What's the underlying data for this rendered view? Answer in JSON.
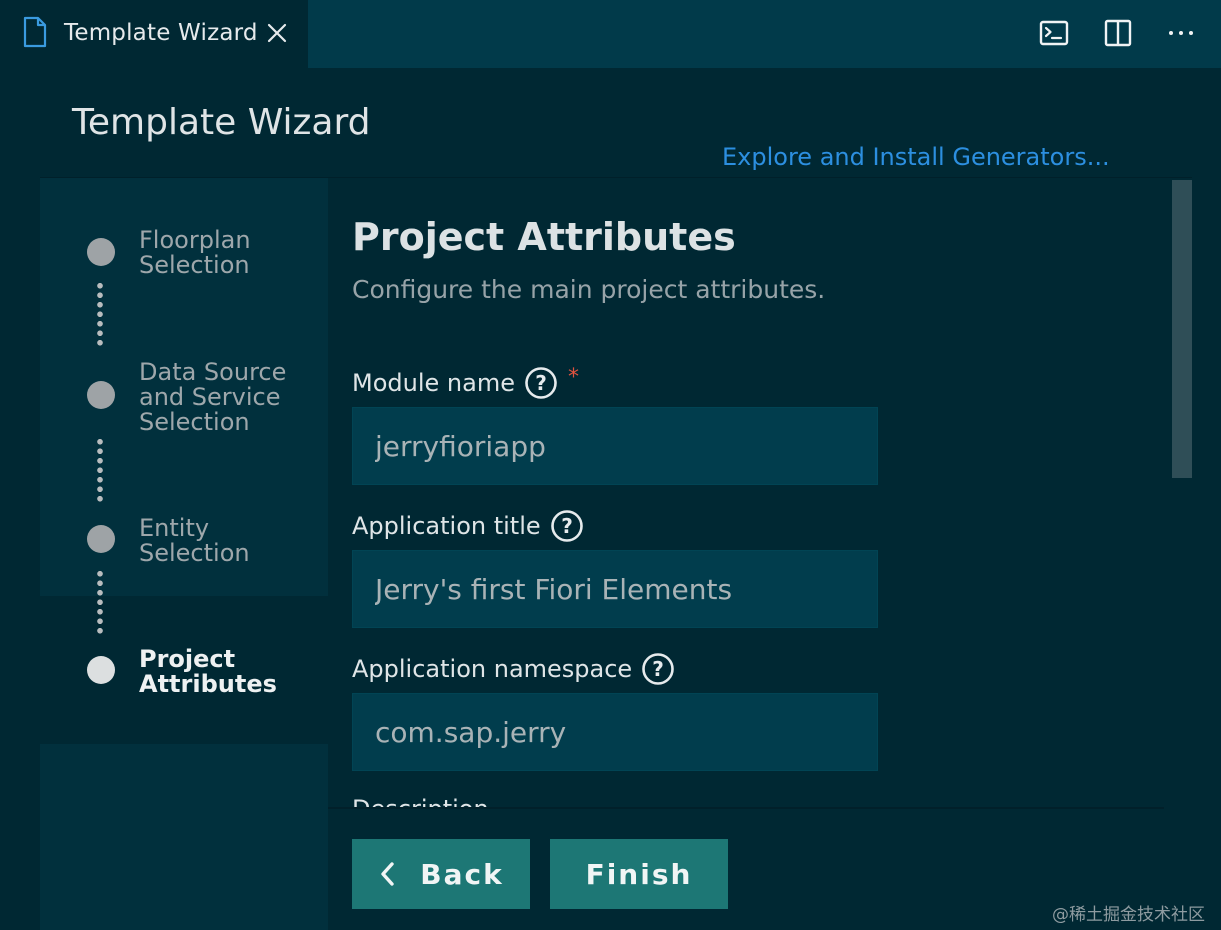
{
  "tab": {
    "title": "Template Wizard"
  },
  "header": {
    "title": "Template Wizard",
    "explore_link": "Explore and Install Generators..."
  },
  "steps": [
    {
      "label": "Floorplan\nSelection",
      "active": false
    },
    {
      "label": "Data Source\nand Service\nSelection",
      "active": false
    },
    {
      "label": "Entity\nSelection",
      "active": false
    },
    {
      "label": "Project\nAttributes",
      "active": true
    }
  ],
  "form": {
    "title": "Project Attributes",
    "subtitle": "Configure the main project attributes.",
    "fields": [
      {
        "label": "Module name",
        "value": "jerryfioriapp",
        "required": true
      },
      {
        "label": "Application title",
        "value": "Jerry's first Fiori Elements",
        "required": false
      },
      {
        "label": "Application namespace",
        "value": "com.sap.jerry",
        "required": false
      },
      {
        "label": "Description",
        "value": "",
        "required": false
      }
    ],
    "required_mark": "*"
  },
  "buttons": {
    "back": "Back",
    "finish": "Finish"
  },
  "watermark": "@稀土掘金技术社区",
  "colors": {
    "background": "#002833",
    "tabbar": "#013a4a",
    "link": "#2c8fe0",
    "button": "#1d7775",
    "required": "#e0533f"
  }
}
